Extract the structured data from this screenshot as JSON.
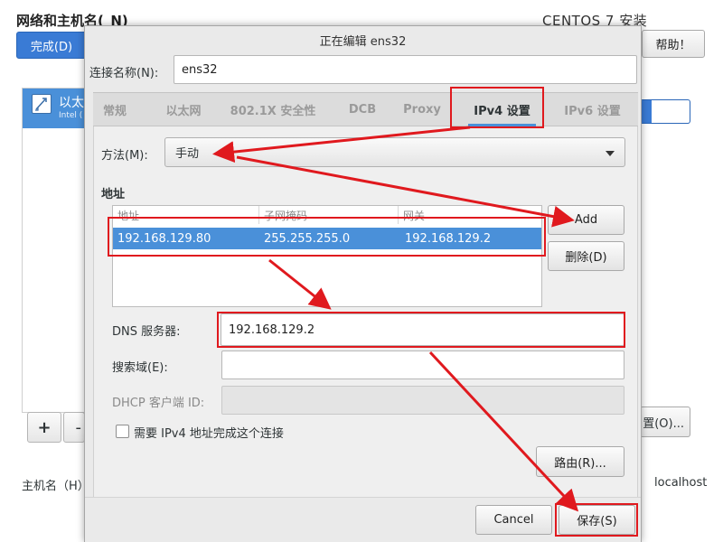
{
  "background": {
    "title": "网络和主机名(_N)",
    "product": "CENTOS 7 安装",
    "done_button": "完成(D)",
    "help_button": "帮助！",
    "device_name": "以太",
    "device_subtitle": "Intel (",
    "add_device_button": "+",
    "remove_device_button": "-",
    "configure_button": "置(O)...",
    "hostname_label": "主机名（H）",
    "hostname_value": "localhost",
    "accent_color": "#3a7bd5"
  },
  "dialog": {
    "title": "正在编辑 ens32",
    "connection_name_label": "连接名称(N):",
    "connection_name_value": "ens32",
    "tabs": [
      {
        "label": "常规"
      },
      {
        "label": "以太网"
      },
      {
        "label": "802.1X 安全性"
      },
      {
        "label": "DCB"
      },
      {
        "label": "Proxy"
      },
      {
        "label": "IPv4 设置"
      },
      {
        "label": "IPv6 设置"
      }
    ],
    "active_tab": "IPv4 设置",
    "method_label": "方法(M):",
    "method_value": "手动",
    "addresses_heading": "地址",
    "address_columns": [
      "地址",
      "子网掩码",
      "网关"
    ],
    "addresses": [
      {
        "address": "192.168.129.80",
        "netmask": "255.255.255.0",
        "gateway": "192.168.129.2"
      }
    ],
    "add_button": "Add",
    "delete_button": "删除(D)",
    "dns_label": "DNS 服务器:",
    "dns_value": "192.168.129.2",
    "search_domain_label": "搜索域(E):",
    "search_domain_value": "",
    "dhcp_client_id_label": "DHCP 客户端 ID:",
    "dhcp_client_id_value": "",
    "require_ipv4_label": "需要 IPv4 地址完成这个连接",
    "require_ipv4_checked": false,
    "routes_button": "路由(R)...",
    "cancel_button": "Cancel",
    "save_button": "保存(S)",
    "selection_color": "#4a90d9",
    "annotation_color": "#e0191e"
  }
}
